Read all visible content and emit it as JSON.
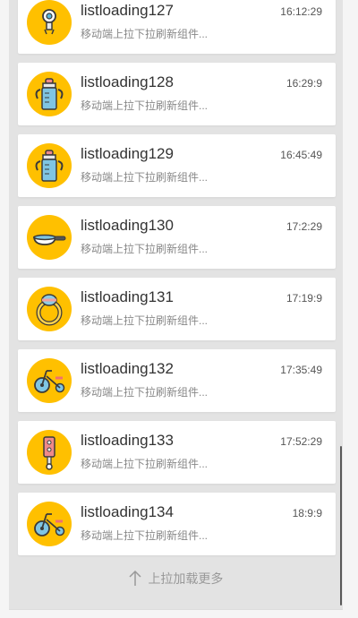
{
  "items": [
    {
      "title": "listloading127",
      "time": "16:12:29",
      "desc": "移动端上拉下拉刷新组件...",
      "icon": "pacifier-icon"
    },
    {
      "title": "listloading128",
      "time": "16:29:9",
      "desc": "移动端上拉下拉刷新组件...",
      "icon": "baby-bottle-icon"
    },
    {
      "title": "listloading129",
      "time": "16:45:49",
      "desc": "移动端上拉下拉刷新组件...",
      "icon": "baby-bottle-icon"
    },
    {
      "title": "listloading130",
      "time": "17:2:29",
      "desc": "移动端上拉下拉刷新组件...",
      "icon": "pan-icon"
    },
    {
      "title": "listloading131",
      "time": "17:19:9",
      "desc": "移动端上拉下拉刷新组件...",
      "icon": "teething-ring-icon"
    },
    {
      "title": "listloading132",
      "time": "17:35:49",
      "desc": "移动端上拉下拉刷新组件...",
      "icon": "tricycle-icon"
    },
    {
      "title": "listloading133",
      "time": "17:52:29",
      "desc": "移动端上拉下拉刷新组件...",
      "icon": "rattle-icon"
    },
    {
      "title": "listloading134",
      "time": "18:9:9",
      "desc": "移动端上拉下拉刷新组件...",
      "icon": "tricycle-icon"
    }
  ],
  "footer": {
    "label": "上拉加载更多",
    "icon": "arrow-up-icon"
  },
  "colors": {
    "avatar_bg": "#ffc000",
    "background": "#e3e3e3"
  }
}
